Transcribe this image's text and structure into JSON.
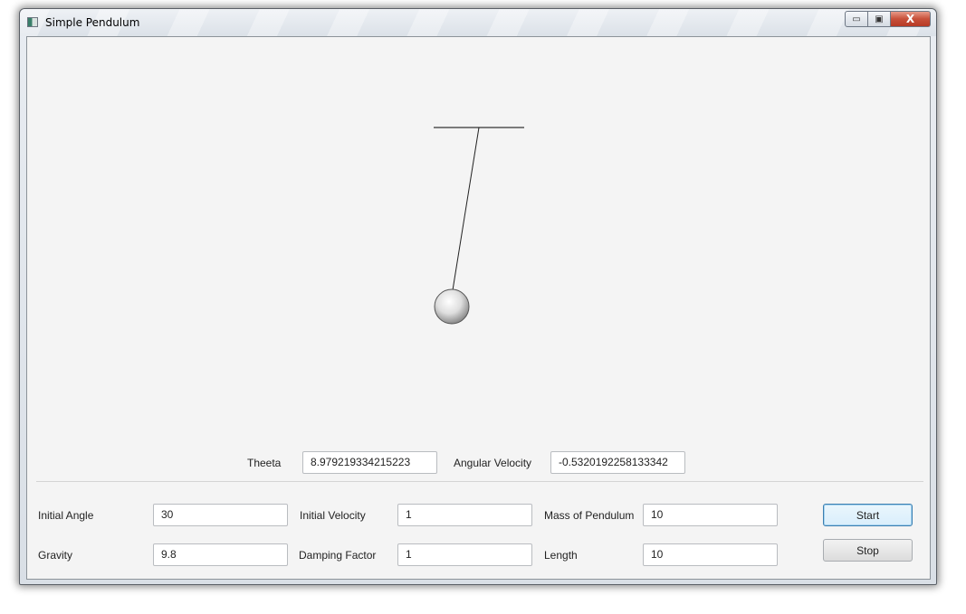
{
  "window": {
    "title": "Simple Pendulum",
    "controls": {
      "minimize": "▭",
      "maximize": "▣",
      "close": "X"
    }
  },
  "status": {
    "theta_label": "Theeta",
    "theta_value": "8.979219334215223",
    "angular_velocity_label": "Angular Velocity",
    "angular_velocity_value": "-0.5320192258133342"
  },
  "params": {
    "initial_angle_label": "Initial Angle",
    "initial_angle_value": "30",
    "initial_velocity_label": "Initial Velocity",
    "initial_velocity_value": "1",
    "mass_label": "Mass of Pendulum",
    "mass_value": "10",
    "gravity_label": "Gravity",
    "gravity_value": "9.8",
    "damping_label": "Damping Factor",
    "damping_value": "1",
    "length_label": "Length",
    "length_value": "10"
  },
  "buttons": {
    "start": "Start",
    "stop": "Stop"
  },
  "icons": {
    "app": "app-window-icon"
  }
}
